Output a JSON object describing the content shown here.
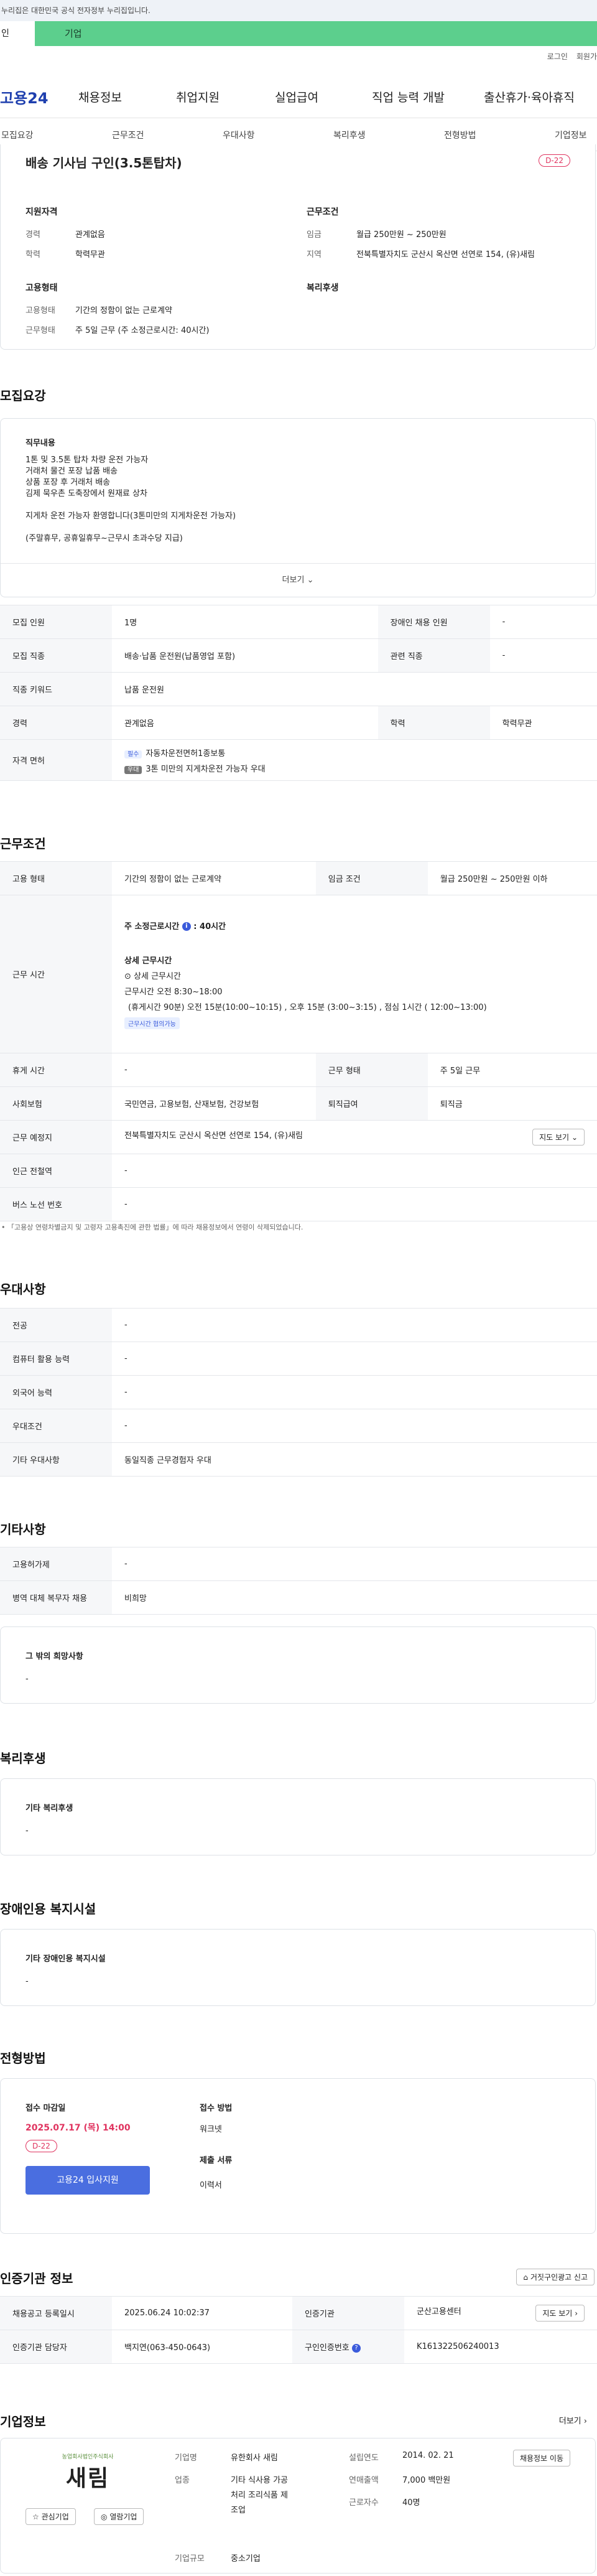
{
  "gov_banner": "누리집은 대한민국 공식 전자정부 누리집입니다.",
  "tabs": {
    "left": "인",
    "right": "기업"
  },
  "toplinks": [
    "로그인",
    "회원가"
  ],
  "header": {
    "logo": "고용24",
    "menu": [
      "채용정보",
      "취업지원",
      "실업급여",
      "직업 능력 개발",
      "출산휴가·육아휴직"
    ]
  },
  "subnav": [
    "모집요강",
    "근무조건",
    "우대사항",
    "복리후생",
    "전형방법",
    "기업정보"
  ],
  "summary": {
    "title": "배송 기사님 구인(3.5톤탑차)",
    "dday": "D-22",
    "qual_title": "지원자격",
    "qual_rows": [
      [
        "경력",
        "관계없음"
      ],
      [
        "학력",
        "학력무관"
      ]
    ],
    "cond_title": "근무조건",
    "cond_rows": [
      [
        "임금",
        "월급 250만원 ~ 250만원"
      ],
      [
        "지역",
        "전북특별자치도 군산시 옥산면 선연로 154, (유)새림"
      ]
    ],
    "emp_title": "고용형태",
    "emp_rows": [
      [
        "고용형태",
        "기간의 정함이 없는 근로계약"
      ],
      [
        "근무형태",
        "주 5일 근무 (주 소정근로시간: 40시간)"
      ]
    ],
    "welfare_title": "복리후생"
  },
  "recruit": {
    "heading": "모집요강",
    "duty_title": "직무내용",
    "duty_lines": [
      "1톤 및 3.5톤 탑차 차량 운전 가능자",
      "거래처 물건 포장 납품 배송",
      "상품 포장 후 거래처 배송",
      "김제 묵우촌 도축장에서 원재료 상차",
      "",
      "지게차 운전 가능자 환영합니다(3톤미만의 지게차운전 가능자)",
      "",
      "(주말휴무, 공휴일휴무~근무시 초과수당 지급)"
    ],
    "more": "더보기",
    "table": [
      [
        "모집 인원",
        "1명",
        "장애인 채용 인원",
        "-"
      ],
      [
        "모집 직종",
        "배송·납품 운전원(납품영업 포함)",
        "관련 직종",
        "-"
      ],
      [
        "직종 키워드",
        "납품 운전원",
        "",
        ""
      ],
      [
        "경력",
        "관계없음",
        "학력",
        "학력무관"
      ]
    ],
    "license_label": "자격 면허",
    "license1_tag": "필수",
    "license1": "자동차운전면허1종보통",
    "license2_tag": "우대",
    "license2": "3톤 미만의 지게차운전 가능자 우대"
  },
  "work": {
    "heading": "근무조건",
    "emp_type": [
      "고용 형태",
      "기간의 정함이 없는 근로계약",
      "임금 조건",
      "월급 250만원 ~ 250만원 이하"
    ],
    "hours_label": "근무 시간",
    "weekly": "주 소정근로시간",
    "weekly_val": "40시간",
    "detail_title": "상세 근무시간",
    "detail_sub": "상세 근무시간",
    "detail_line1": "근무시간 오전 8:30~18:00",
    "detail_line2": "(휴게시간 90분) 오전 15분(10:00~10:15) , 오후 15분 (3:00~3:15) , 점심 1시간 ( 12:00~13:00)",
    "flex_tag": "근무시간 협의가능",
    "rows": [
      [
        "휴게 시간",
        "-",
        "근무 형태",
        "주 5일 근무"
      ],
      [
        "사회보험",
        "국민연금, 고용보험, 산재보험, 건강보험",
        "퇴직급여",
        "퇴직금"
      ]
    ],
    "place_label": "근무 예정지",
    "place": "전북특별자치도 군산시 옥산면 선연로 154, (유)새림",
    "map_btn": "지도 보기",
    "near_label": "인근 전철역",
    "near": "-",
    "bus_label": "버스 노선 번호",
    "bus": "-",
    "notice": "「고용상 연령차별금지 및 고령자 고용촉진에 관한 법률」에 따라 채용정보에서 연령이 삭제되었습니다."
  },
  "pref": {
    "heading": "우대사항",
    "rows": [
      [
        "전공",
        "-"
      ],
      [
        "컴퓨터 활용 능력",
        "-"
      ],
      [
        "외국어 능력",
        "-"
      ],
      [
        "우대조건",
        "-"
      ],
      [
        "기타 우대사항",
        "동일직종 근무경험자 우대"
      ]
    ]
  },
  "etc": {
    "heading": "기타사항",
    "rows": [
      [
        "고용허가제",
        "-"
      ],
      [
        "병역 대체 복무자 채용",
        "비희망"
      ]
    ],
    "hope_title": "그 밖의 희망사항",
    "hope_val": "-"
  },
  "welfare": {
    "heading": "복리후생",
    "box_title": "기타 복리후생",
    "box_val": "-"
  },
  "disab": {
    "heading": "장애인용 복지시설",
    "box_title": "기타 장애인용 복지시설",
    "box_val": "-"
  },
  "screening": {
    "heading": "전형방법",
    "deadline_label": "접수 마감일",
    "deadline": "2025.07.17 (목) 14:00",
    "dday": "D-22",
    "apply_btn": "고용24 입사지원",
    "method_label": "접수 방법",
    "method": "워크넷",
    "docs_label": "제출 서류",
    "docs": "이력서"
  },
  "cert": {
    "heading": "인증기관 정보",
    "report_btn": "거짓구인광고 신고",
    "rows": [
      [
        "채용공고 등록일시",
        "2025.06.24 10:02:37",
        "인증기관",
        "군산고용센터"
      ],
      [
        "인증기관 담당자",
        "백지연(063-450-0643)",
        "구인인증번호",
        "K161322506240013"
      ]
    ],
    "map_btn": "지도 보기"
  },
  "company": {
    "heading": "기업정보",
    "more": "더보기",
    "logo_text": "새림",
    "logo_sub": "농업회사법인주식회사",
    "fav_btn": "관심기업",
    "hire_btn": "열람기업",
    "rows": [
      [
        "기업명",
        "유한회사 새림",
        "설립연도",
        "2014. 02. 21"
      ],
      [
        "업종",
        "기타 식사용 가공처리 조리식품 제조업",
        "연매출액",
        "7,000 백만원"
      ],
      [
        "",
        "",
        "근로자수",
        "40명"
      ],
      [
        "기업규모",
        "중소기업",
        "",
        ""
      ]
    ],
    "jobs_btn": "채용정보 이동"
  },
  "colors": {
    "accent": "#3b5bdb",
    "dday": "#e0335f",
    "tab_green": "#5ccf8d"
  }
}
